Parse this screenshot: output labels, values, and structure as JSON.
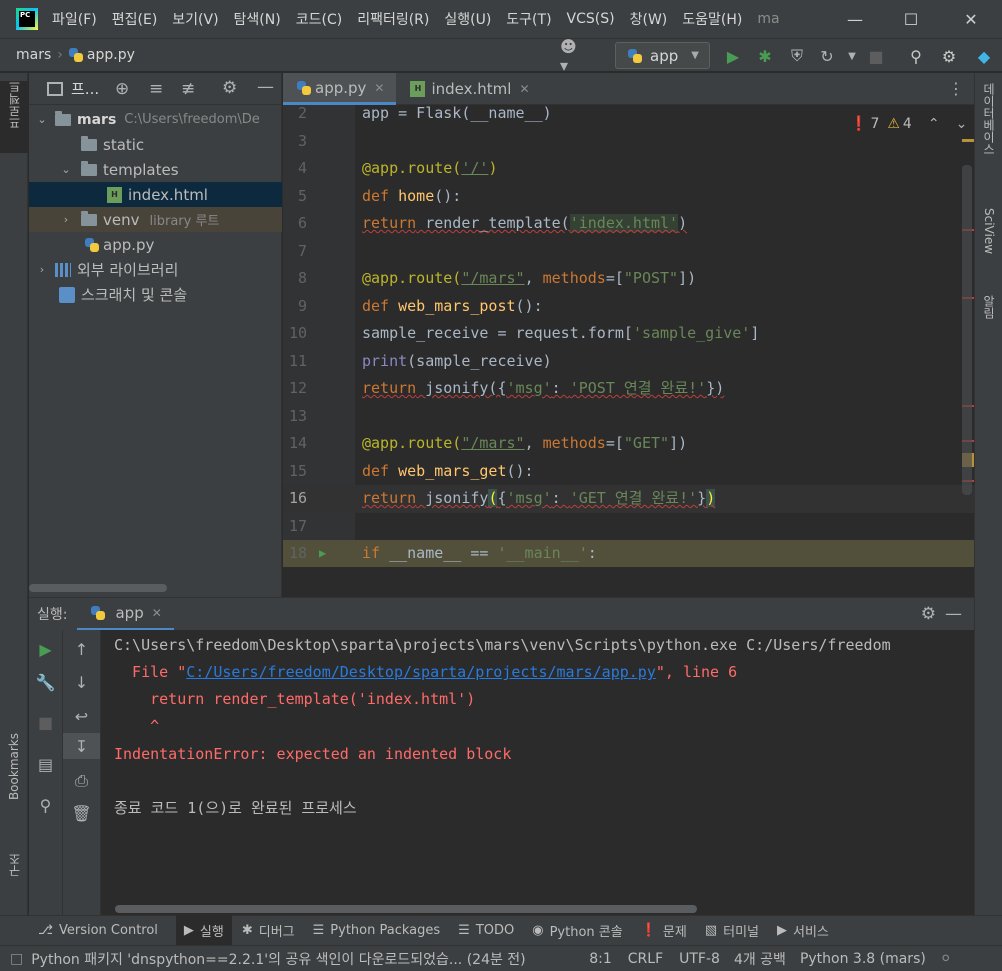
{
  "titlebar": {
    "menu": [
      "파일(F)",
      "편집(E)",
      "보기(V)",
      "탐색(N)",
      "코드(C)",
      "리팩터링(R)",
      "실행(U)",
      "도구(T)",
      "VCS(S)",
      "창(W)",
      "도움말(H)"
    ],
    "title": "ma",
    "logo_text": "PC"
  },
  "navbar": {
    "project": "mars",
    "file": "app.py",
    "run_config": "app"
  },
  "left_strip": {
    "project_tab": "프로젝트",
    "bookmarks_tab": "Bookmarks",
    "structure_tab": "구조"
  },
  "right_strip": {
    "database_tab": "데이터베이스",
    "sciview_tab": "SciView",
    "notifications_tab": "알림"
  },
  "project_panel": {
    "title": "프...",
    "tree": [
      {
        "label": "mars",
        "hint": "C:\\Users\\freedom\\De"
      },
      {
        "label": "static"
      },
      {
        "label": "templates"
      },
      {
        "label": "index.html"
      },
      {
        "label": "venv",
        "hint": "library 루트"
      },
      {
        "label": "app.py"
      },
      {
        "label": "외부 라이브러리"
      },
      {
        "label": "스크래치 및 콘솔"
      }
    ]
  },
  "editor": {
    "tabs": [
      "app.py",
      "index.html"
    ],
    "errors": "7",
    "warnings": "4",
    "line_numbers": [
      "2",
      "3",
      "4",
      "5",
      "6",
      "7",
      "8",
      "9",
      "10",
      "11",
      "12",
      "13",
      "14",
      "15",
      "16",
      "17",
      "18"
    ],
    "code": {
      "l2": "app = Flask(__name__)",
      "l4_dec": "@app.route(",
      "l4_str": "'/'",
      "l4_end": ")",
      "l5_kw": "def ",
      "l5_fn": "home",
      "l5_end": "():",
      "l6_kw": "return",
      "l6_mid": " render_template(",
      "l6_str": "'index.html'",
      "l6_end": ")",
      "l8_dec": "@app.route(",
      "l8_str": "\"/mars\"",
      "l8_sep": ", ",
      "l8_kw": "methods",
      "l8_eq": "=[",
      "l8_str2": "\"POST\"",
      "l8_end": "])",
      "l9_kw": "def ",
      "l9_fn": "web_mars_post",
      "l9_end": "():",
      "l10_a": "sample_receive = request.form[",
      "l10_str": "'sample_give'",
      "l10_end": "]",
      "l11_kw": "print",
      "l11_end": "(sample_receive)",
      "l12_kw": "return",
      "l12_mid": " jsonify({",
      "l12_str": "'msg'",
      "l12_sep": ": ",
      "l12_str2": "'POST 연결 완료!'",
      "l12_end": "})",
      "l14_dec": "@app.route(",
      "l14_str": "\"/mars\"",
      "l14_sep": ", ",
      "l14_kw": "methods",
      "l14_eq": "=[",
      "l14_str2": "\"GET\"",
      "l14_end": "])",
      "l15_kw": "def ",
      "l15_fn": "web_mars_get",
      "l15_end": "():",
      "l16_kw": "return",
      "l16_mid": " jsonify",
      "l16_p1": "(",
      "l16_b1": "{",
      "l16_str": "'msg'",
      "l16_sep": ": ",
      "l16_str2": "'GET 연결 완료!'",
      "l16_b2": "}",
      "l16_p2": ")",
      "l18_kw": "if ",
      "l18_mid": "__name__ == ",
      "l18_str": "'__main__'",
      "l18_end": ":"
    }
  },
  "run_panel": {
    "label": "실행:",
    "tab": "app",
    "console": {
      "cmd": "C:\\Users\\freedom\\Desktop\\sparta\\projects\\mars\\venv\\Scripts\\python.exe C:/Users/freedom",
      "file_prefix": "  File \"",
      "file_path": "C:/Users/freedom/Desktop/sparta/projects/mars/app.py",
      "file_suffix": "\", line 6",
      "code_line": "    return render_template('index.html')",
      "caret": "    ^",
      "error": "IndentationError: expected an indented block",
      "exit": "종료 코드 1(으)로 완료된 프로세스"
    }
  },
  "bottom_tools": [
    "Version Control",
    "실행",
    "디버그",
    "Python Packages",
    "TODO",
    "Python 콘솔",
    "문제",
    "터미널",
    "서비스"
  ],
  "status_bar": {
    "message": "Python 패키지 'dnspython==2.2.1'의 공유 색인이 다운로드되었습... (24분 전)",
    "position": "8:1",
    "line_sep": "CRLF",
    "encoding": "UTF-8",
    "indent": "4개 공백",
    "interpreter": "Python 3.8 (mars)"
  },
  "colors": {
    "background": "#2b2b2b",
    "panel": "#3c3f41",
    "accent": "#4a88c7",
    "error": "#ff6b68",
    "run_green": "#499c54"
  }
}
